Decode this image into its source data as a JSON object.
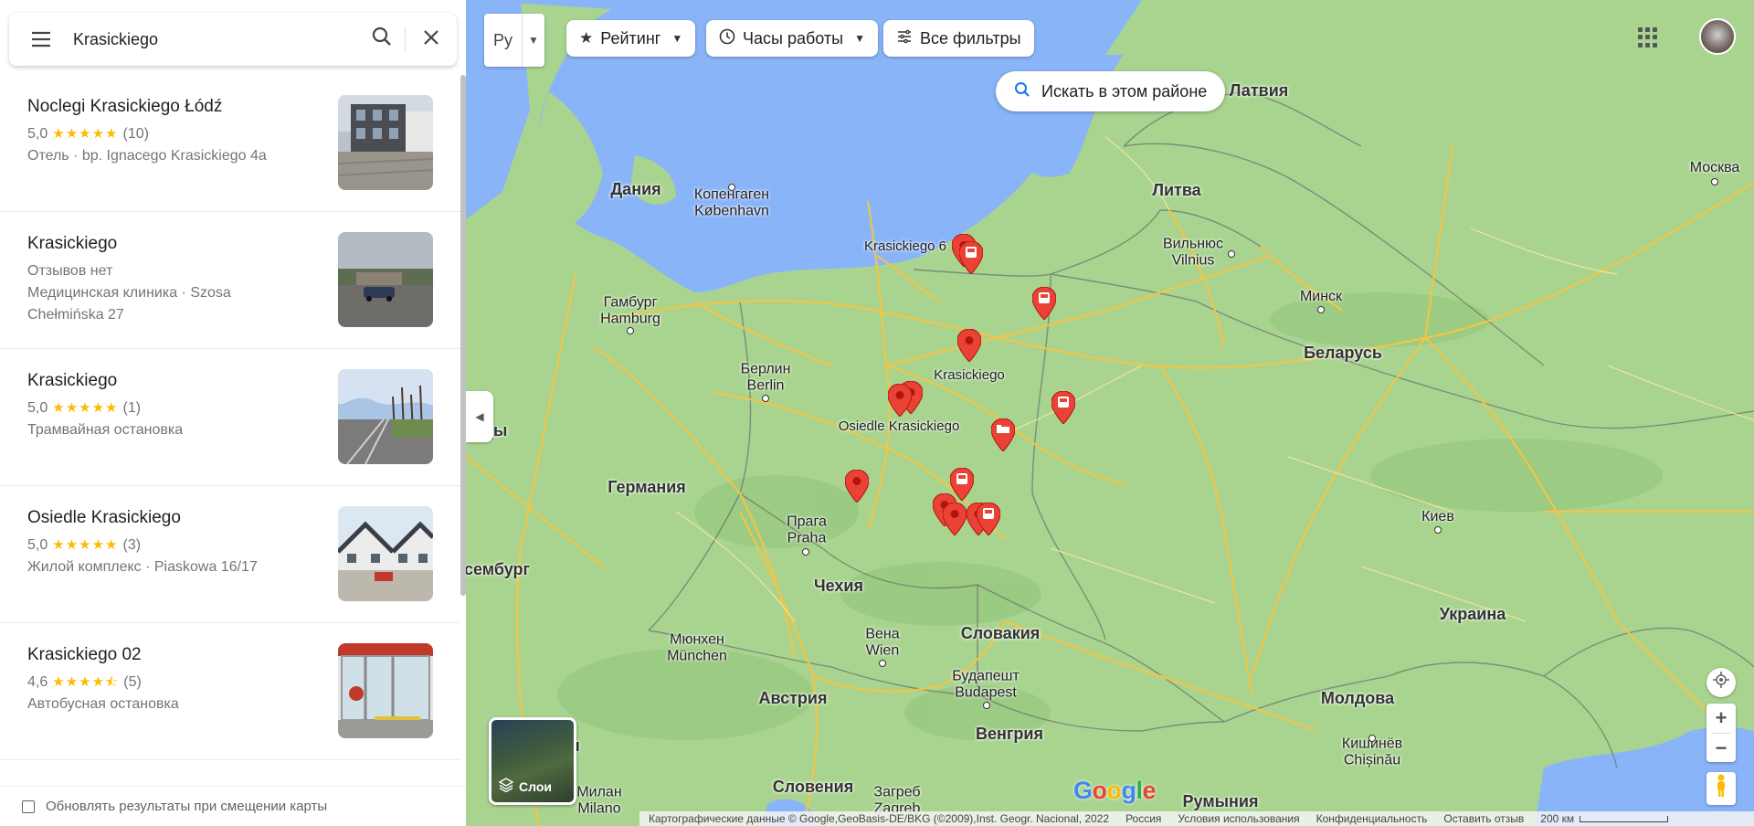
{
  "search": {
    "query": "Krasickiego"
  },
  "results": [
    {
      "name": "Noclegi Krasickiego Łódź",
      "rating": "5,0",
      "stars": "★★★★★",
      "count": "(10)",
      "lines": [
        "Отель · bp. Ignacego Krasickiego 4a"
      ]
    },
    {
      "name": "Krasickiego",
      "rating": "",
      "stars": "",
      "count": "",
      "lines": [
        "Отзывов нет",
        "Медицинская клиника · Szosa Chełmińska 27"
      ]
    },
    {
      "name": "Krasickiego",
      "rating": "5,0",
      "stars": "★★★★★",
      "count": "(1)",
      "lines": [
        "Трамвайная остановка"
      ]
    },
    {
      "name": "Osiedle Krasickiego",
      "rating": "5,0",
      "stars": "★★★★★",
      "count": "(3)",
      "lines": [
        "Жилой комплекс · Piaskowa 16/17"
      ]
    },
    {
      "name": "Krasickiego 02",
      "rating": "4,6",
      "stars": "★★★★⯪",
      "count": "(5)",
      "lines": [
        "Автобусная остановка"
      ]
    }
  ],
  "update_label": "Обновлять результаты при смещении карты",
  "map": {
    "lang_label": "Ру",
    "chips": {
      "rating": "Рейтинг",
      "hours": "Часы работы",
      "filters": "Все фильтры"
    },
    "search_area": "Искать в этом районе",
    "layers_label": "Слои",
    "labels": {
      "denmark": "Дания",
      "latvia": "Латвия",
      "lithuania": "Литва",
      "belarus": "Беларусь",
      "germany": "Германия",
      "czech": "Чехия",
      "slovakia": "Словакия",
      "austria": "Австрия",
      "hungary": "Венгрия",
      "slovenia": "Словения",
      "romania": "Румыния",
      "ukraine": "Украина",
      "moldova": "Молдова",
      "nl_partial": "ды",
      "lux_partial": "сембург",
      "it_partial": "ия",
      "copenhagen": "Копенгаген\nKøbenhavn",
      "hamburg": "Гамбург\nHamburg",
      "berlin": "Берлин\nBerlin",
      "prague": "Прага\nPraha",
      "munich": "Мюнхен\nMünchen",
      "vienna": "Вена\nWien",
      "budapest": "Будапешт\nBudapest",
      "milan": "Милан\nMilano",
      "zagreb": "Загреб\nZagreb",
      "vilnius": "Вильнюс\nVilnius",
      "minsk": "Минск",
      "moscow": "Москва",
      "kyiv": "Киев",
      "chisinau": "Кишинёв\nChișinău",
      "pin_k6": "Krasickiego 6",
      "pin_k": "Krasickiego",
      "pin_osiedle": "Osiedle Krasickiego"
    },
    "attribution": "Картографические данные © Google,GeoBasis-DE/BKG (©2009),Inst. Geogr. Nacional, 2022",
    "footer_links": [
      "Россия",
      "Условия использования",
      "Конфиденциальность",
      "Оставить отзыв"
    ],
    "scale": "200 км",
    "colors": {
      "water": "#8ab4f8",
      "land": "#a8d490",
      "road": "#f6c544",
      "pin": "#ea4335"
    }
  }
}
